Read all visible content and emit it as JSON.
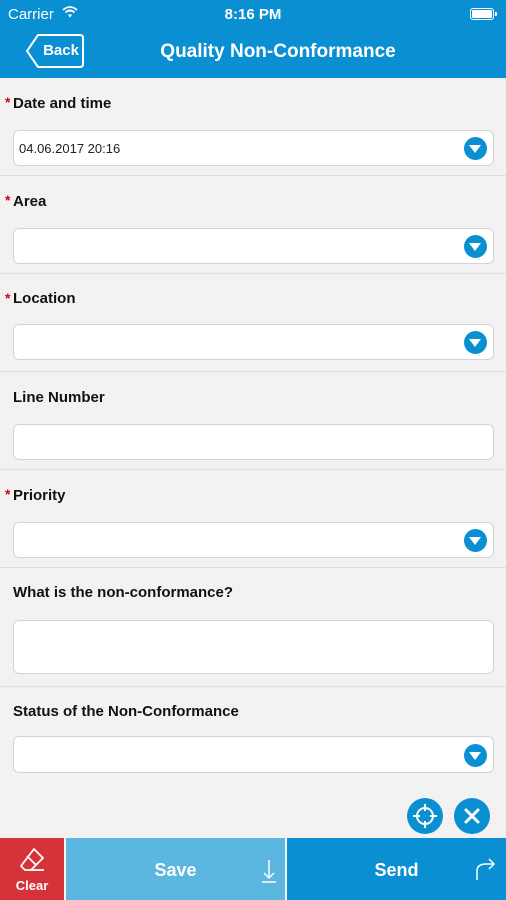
{
  "status_bar": {
    "carrier": "Carrier",
    "time": "8:16 PM"
  },
  "nav": {
    "back_label": "Back",
    "title": "Quality Non-Conformance"
  },
  "fields": [
    {
      "label": "Date and time",
      "required": true,
      "value": "04.06.2017 20:16",
      "type": "dropdown"
    },
    {
      "label": "Area",
      "required": true,
      "value": "",
      "type": "dropdown"
    },
    {
      "label": "Location",
      "required": true,
      "value": "",
      "type": "dropdown"
    },
    {
      "label": "Line Number",
      "required": false,
      "value": "",
      "type": "text"
    },
    {
      "label": "Priority",
      "required": true,
      "value": "",
      "type": "dropdown"
    },
    {
      "label": "What is the non-conformance?",
      "required": false,
      "value": "",
      "type": "textarea"
    },
    {
      "label": "Status of the Non-Conformance",
      "required": false,
      "value": "",
      "type": "dropdown"
    }
  ],
  "required_marker": "*",
  "actions": {
    "clear_label": "Clear",
    "save_label": "Save",
    "send_label": "Send"
  },
  "icons": {
    "wifi": "wifi-icon",
    "battery": "battery-icon",
    "back": "back-arrow-icon",
    "dropdown": "chevron-down-icon",
    "locate": "crosshair-icon",
    "cancel": "close-icon",
    "clear": "eraser-icon",
    "save": "download-icon",
    "send": "forward-arrow-icon"
  },
  "colors": {
    "primary": "#0b8fd3",
    "save": "#5bb6e0",
    "clear": "#d6323a",
    "required": "#d0021b"
  }
}
